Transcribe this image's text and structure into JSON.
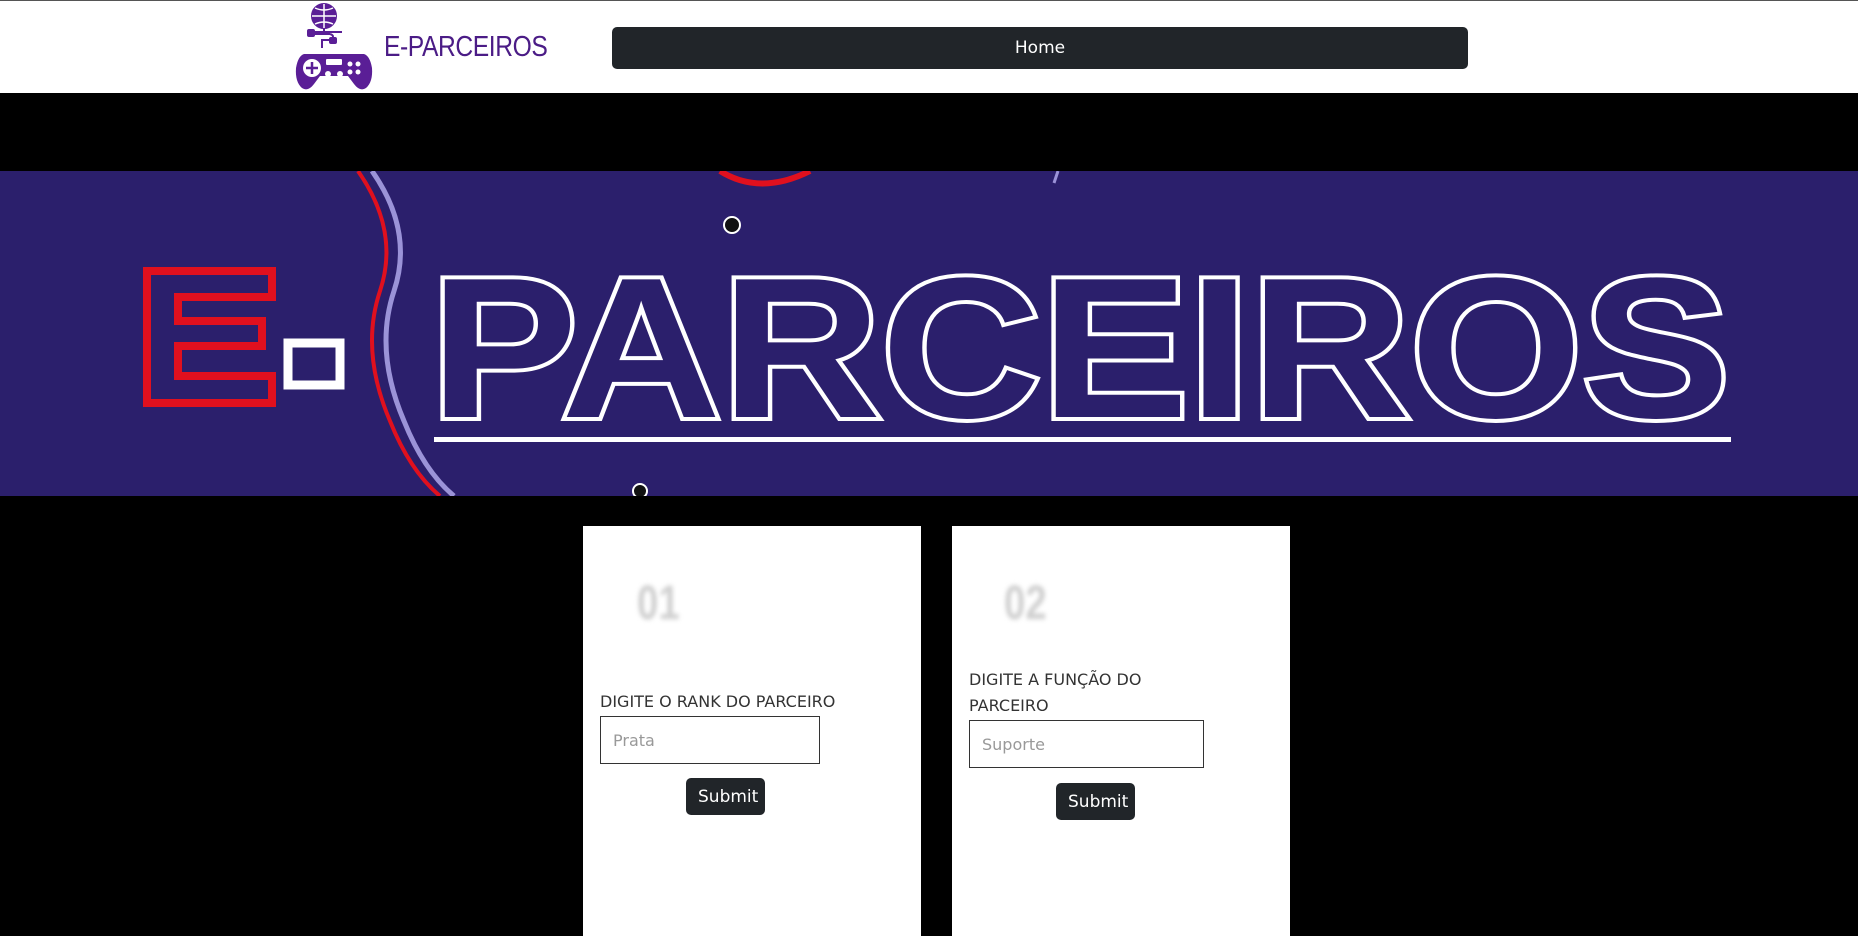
{
  "navbar": {
    "brand": "E-PARCEIROS",
    "home_label": "Home"
  },
  "banner": {
    "title_prefix": "E-",
    "title_main": "PARCEIROS"
  },
  "cards": [
    {
      "number": "01",
      "label": "DIGITE O RANK DO PARCEIRO",
      "placeholder": "Prata",
      "submit_label": "Submit"
    },
    {
      "number": "02",
      "label": "DIGITE A FUNÇÃO DO PARCEIRO",
      "placeholder": "Suporte",
      "submit_label": "Submit"
    }
  ],
  "colors": {
    "brand_purple": "#4b1c86",
    "banner_bg": "#2b1f6c",
    "button_dark": "#212529",
    "accent_red": "#e0101e"
  }
}
